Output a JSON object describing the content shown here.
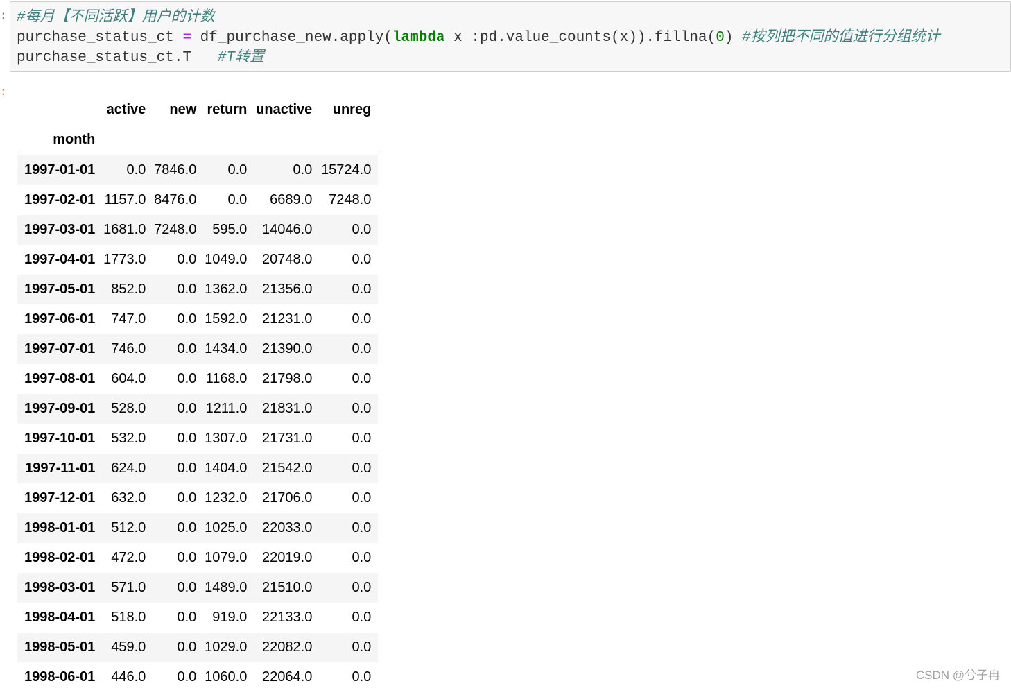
{
  "notebook": {
    "input_prompt": ":",
    "output_prompt": ":",
    "code_lines": [
      [
        {
          "text": "#每月【不同活跃】用户的计数",
          "kind": "comment"
        }
      ],
      [
        {
          "text": "purchase_status_ct ",
          "kind": "plain"
        },
        {
          "text": "=",
          "kind": "op"
        },
        {
          "text": " df_purchase_new.apply(",
          "kind": "plain"
        },
        {
          "text": "lambda",
          "kind": "kw"
        },
        {
          "text": " x :pd.value_counts(x)).fillna(",
          "kind": "plain"
        },
        {
          "text": "0",
          "kind": "num"
        },
        {
          "text": ") ",
          "kind": "plain"
        },
        {
          "text": "#按列把不同的值进行分组统计",
          "kind": "comment"
        }
      ],
      [
        {
          "text": "purchase_status_ct.T   ",
          "kind": "plain"
        },
        {
          "text": "#T转置",
          "kind": "comment"
        }
      ]
    ]
  },
  "dataframe": {
    "index_name": "month",
    "columns": [
      "active",
      "new",
      "return",
      "unactive",
      "unreg"
    ],
    "rows": [
      {
        "index": "1997-01-01",
        "values": [
          "0.0",
          "7846.0",
          "0.0",
          "0.0",
          "15724.0"
        ]
      },
      {
        "index": "1997-02-01",
        "values": [
          "1157.0",
          "8476.0",
          "0.0",
          "6689.0",
          "7248.0"
        ]
      },
      {
        "index": "1997-03-01",
        "values": [
          "1681.0",
          "7248.0",
          "595.0",
          "14046.0",
          "0.0"
        ]
      },
      {
        "index": "1997-04-01",
        "values": [
          "1773.0",
          "0.0",
          "1049.0",
          "20748.0",
          "0.0"
        ]
      },
      {
        "index": "1997-05-01",
        "values": [
          "852.0",
          "0.0",
          "1362.0",
          "21356.0",
          "0.0"
        ]
      },
      {
        "index": "1997-06-01",
        "values": [
          "747.0",
          "0.0",
          "1592.0",
          "21231.0",
          "0.0"
        ]
      },
      {
        "index": "1997-07-01",
        "values": [
          "746.0",
          "0.0",
          "1434.0",
          "21390.0",
          "0.0"
        ]
      },
      {
        "index": "1997-08-01",
        "values": [
          "604.0",
          "0.0",
          "1168.0",
          "21798.0",
          "0.0"
        ]
      },
      {
        "index": "1997-09-01",
        "values": [
          "528.0",
          "0.0",
          "1211.0",
          "21831.0",
          "0.0"
        ]
      },
      {
        "index": "1997-10-01",
        "values": [
          "532.0",
          "0.0",
          "1307.0",
          "21731.0",
          "0.0"
        ]
      },
      {
        "index": "1997-11-01",
        "values": [
          "624.0",
          "0.0",
          "1404.0",
          "21542.0",
          "0.0"
        ]
      },
      {
        "index": "1997-12-01",
        "values": [
          "632.0",
          "0.0",
          "1232.0",
          "21706.0",
          "0.0"
        ]
      },
      {
        "index": "1998-01-01",
        "values": [
          "512.0",
          "0.0",
          "1025.0",
          "22033.0",
          "0.0"
        ]
      },
      {
        "index": "1998-02-01",
        "values": [
          "472.0",
          "0.0",
          "1079.0",
          "22019.0",
          "0.0"
        ]
      },
      {
        "index": "1998-03-01",
        "values": [
          "571.0",
          "0.0",
          "1489.0",
          "21510.0",
          "0.0"
        ]
      },
      {
        "index": "1998-04-01",
        "values": [
          "518.0",
          "0.0",
          "919.0",
          "22133.0",
          "0.0"
        ]
      },
      {
        "index": "1998-05-01",
        "values": [
          "459.0",
          "0.0",
          "1029.0",
          "22082.0",
          "0.0"
        ]
      },
      {
        "index": "1998-06-01",
        "values": [
          "446.0",
          "0.0",
          "1060.0",
          "22064.0",
          "0.0"
        ]
      }
    ]
  },
  "watermark": "CSDN @兮子冉",
  "colors": {
    "cell_background": "#f7f7f7",
    "cell_border": "#cfcfcf",
    "comment": "#408080",
    "keyword": "#008000",
    "operator": "#aa22ff",
    "input_prompt": "#303f9f",
    "output_prompt": "#d84315",
    "row_stripe": "#f5f5f5"
  }
}
